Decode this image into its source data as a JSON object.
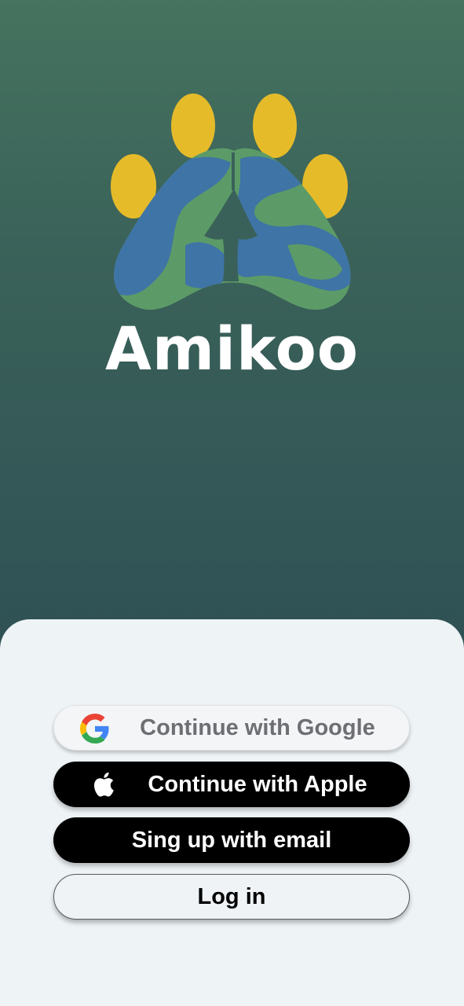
{
  "brand": {
    "name": "Amikoo",
    "logo_icon": "paw-globe-logo",
    "colors": {
      "paw_toes": "#e6bb2a",
      "globe_blue": "#3f74a6",
      "globe_green": "#5c9b67",
      "background_top": "#45735f",
      "background_bottom": "#2f5155"
    }
  },
  "auth": {
    "google": {
      "label": "Continue with Google",
      "icon": "google-icon"
    },
    "apple": {
      "label": "Continue with Apple",
      "icon": "apple-icon"
    },
    "email": {
      "label": "Sing up with email"
    },
    "login": {
      "label": "Log in"
    }
  }
}
